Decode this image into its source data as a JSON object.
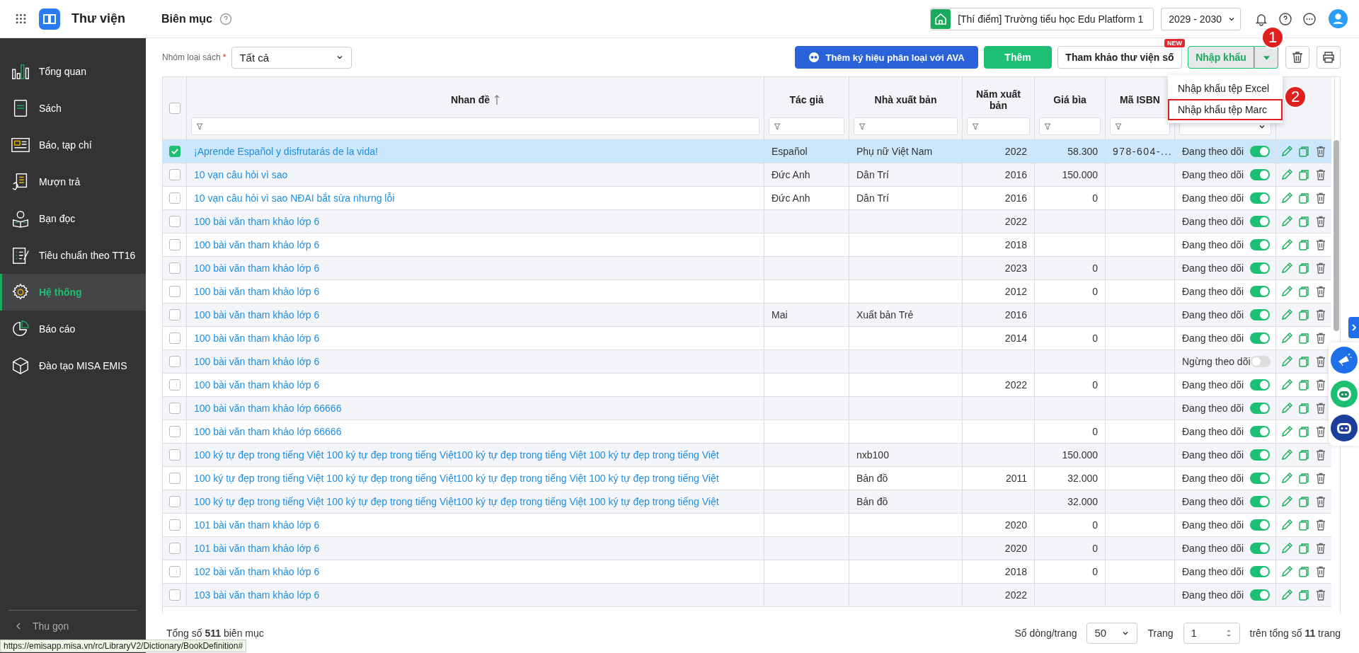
{
  "app": {
    "name": "Thư viện",
    "page_title": "Biên mục",
    "school": "[Thí điểm] Trường tiểu học Edu Platform 1",
    "year": "2029 - 2030"
  },
  "sidebar": {
    "items": [
      {
        "label": "Tổng quan",
        "selected": false
      },
      {
        "label": "Sách",
        "selected": false
      },
      {
        "label": "Báo, tạp chí",
        "selected": false
      },
      {
        "label": "Mượn trả",
        "selected": false
      },
      {
        "label": "Bạn đọc",
        "selected": false
      },
      {
        "label": "Tiêu chuẩn theo TT16",
        "selected": false
      },
      {
        "label": "Hệ thống",
        "selected": true
      },
      {
        "label": "Báo cáo",
        "selected": false
      },
      {
        "label": "Đào tạo MISA EMIS",
        "selected": false
      }
    ],
    "collapse": "Thu gọn"
  },
  "toolbar": {
    "filter_label": "Nhóm loại sách",
    "required_mark": "*",
    "filter_value": "Tất cả",
    "buttons": [
      {
        "label": "Thêm ký hiệu phân loại với AVA",
        "kind": "ava"
      },
      {
        "label": "Thêm",
        "kind": "primary"
      },
      {
        "label": "Tham khảo thư viện số",
        "kind": "outline",
        "badge": "NEW"
      },
      {
        "label": "Nhập khẩu",
        "kind": "split"
      }
    ],
    "import_menu": [
      {
        "label": "Nhập khẩu tệp Excel",
        "highlighted": false
      },
      {
        "label": "Nhập khẩu tệp Marc",
        "highlighted": true
      }
    ],
    "step_markers": [
      "1",
      "2"
    ]
  },
  "table": {
    "all_checked": false,
    "columns": [
      "Nhan đề",
      "Tác giả",
      "Nhà xuất bản",
      "Năm xuất bản",
      "Giá bìa",
      "Mã ISBN"
    ],
    "rows": [
      {
        "selected": true,
        "title": "¡Aprende Español y disfrutarás de la vida!",
        "author": "Español",
        "publisher": "Phụ nữ Việt Nam",
        "year": "2022",
        "price": "58.300",
        "isbn": "978-604-...",
        "status": "Đang theo dõi",
        "on": true
      },
      {
        "selected": false,
        "title": "10 vạn câu hỏi vì sao",
        "author": "Đức Anh",
        "publisher": "Dân Trí",
        "year": "2016",
        "price": "150.000",
        "isbn": "",
        "status": "Đang theo dõi",
        "on": true
      },
      {
        "selected": false,
        "title": "10 vạn câu hỏi vì sao NĐAI bắt sửa nhưng lỗi",
        "author": "Đức Anh",
        "publisher": "Dân Trí",
        "year": "2016",
        "price": "0",
        "isbn": "",
        "status": "Đang theo dõi",
        "on": true
      },
      {
        "selected": false,
        "title": "100 bài văn tham khảo lớp 6",
        "author": "",
        "publisher": "",
        "year": "2022",
        "price": "",
        "isbn": "",
        "status": "Đang theo dõi",
        "on": true
      },
      {
        "selected": false,
        "title": "100 bài văn tham khảo lớp 6",
        "author": "",
        "publisher": "",
        "year": "2018",
        "price": "",
        "isbn": "",
        "status": "Đang theo dõi",
        "on": true
      },
      {
        "selected": false,
        "title": "100 bài văn tham khảo lớp 6",
        "author": "",
        "publisher": "",
        "year": "2023",
        "price": "0",
        "isbn": "",
        "status": "Đang theo dõi",
        "on": true
      },
      {
        "selected": false,
        "title": "100 bài văn tham khảo lớp 6",
        "author": "",
        "publisher": "",
        "year": "2012",
        "price": "0",
        "isbn": "",
        "status": "Đang theo dõi",
        "on": true
      },
      {
        "selected": false,
        "title": "100 bài văn tham khảo lớp 6",
        "author": "Mai",
        "publisher": "Xuất bản Trẻ",
        "year": "2016",
        "price": "",
        "isbn": "",
        "status": "Đang theo dõi",
        "on": true
      },
      {
        "selected": false,
        "title": "100 bài văn tham khảo lớp 6",
        "author": "",
        "publisher": "",
        "year": "2014",
        "price": "0",
        "isbn": "",
        "status": "Đang theo dõi",
        "on": true
      },
      {
        "selected": false,
        "title": "100 bài văn tham khảo lớp 6",
        "author": "",
        "publisher": "",
        "year": "",
        "price": "",
        "isbn": "",
        "status": "Ngừng theo dõi",
        "on": false
      },
      {
        "selected": false,
        "title": "100 bài văn tham khảo lớp 6",
        "author": "",
        "publisher": "",
        "year": "2022",
        "price": "0",
        "isbn": "",
        "status": "Đang theo dõi",
        "on": true
      },
      {
        "selected": false,
        "title": "100 bài văn tham khảo lớp 66666",
        "author": "",
        "publisher": "",
        "year": "",
        "price": "",
        "isbn": "",
        "status": "Đang theo dõi",
        "on": true
      },
      {
        "selected": false,
        "title": "100 bài văn tham khảo lớp 66666",
        "author": "",
        "publisher": "",
        "year": "",
        "price": "0",
        "isbn": "",
        "status": "Đang theo dõi",
        "on": true
      },
      {
        "selected": false,
        "title": "100 ký tự đẹp trong tiếng Việt 100 ký tự đẹp trong tiếng Việt100 ký tự đẹp trong tiếng Việt 100 ký tự đẹp trong tiếng Việt",
        "author": "",
        "publisher": "nxb100",
        "year": "",
        "price": "150.000",
        "isbn": "",
        "status": "Đang theo dõi",
        "on": true
      },
      {
        "selected": false,
        "title": "100 ký tự đẹp trong tiếng Việt 100 ký tự đẹp trong tiếng Việt100 ký tự đẹp trong tiếng Việt 100 ký tự đẹp trong tiếng Việt",
        "author": "",
        "publisher": "Bản đồ",
        "year": "2011",
        "price": "32.000",
        "isbn": "",
        "status": "Đang theo dõi",
        "on": true
      },
      {
        "selected": false,
        "title": "100 ký tự đẹp trong tiếng Việt 100 ký tự đẹp trong tiếng Việt100 ký tự đẹp trong tiếng Việt 100 ký tự đẹp trong tiếng Việt",
        "author": "",
        "publisher": "Bản đồ",
        "year": "",
        "price": "32.000",
        "isbn": "",
        "status": "Đang theo dõi",
        "on": true
      },
      {
        "selected": false,
        "title": "101 bài văn tham khảo lớp 6",
        "author": "",
        "publisher": "",
        "year": "2020",
        "price": "0",
        "isbn": "",
        "status": "Đang theo dõi",
        "on": true
      },
      {
        "selected": false,
        "title": "101 bài văn tham khảo lớp 6",
        "author": "",
        "publisher": "",
        "year": "2020",
        "price": "0",
        "isbn": "",
        "status": "Đang theo dõi",
        "on": true
      },
      {
        "selected": false,
        "title": "102 bài văn tham khảo lớp 6",
        "author": "",
        "publisher": "",
        "year": "2018",
        "price": "0",
        "isbn": "",
        "status": "Đang theo dõi",
        "on": true
      },
      {
        "selected": false,
        "title": "103 bài văn tham khảo lớp 6",
        "author": "",
        "publisher": "",
        "year": "2022",
        "price": "",
        "isbn": "",
        "status": "Đang theo dõi",
        "on": true
      }
    ]
  },
  "footer": {
    "total": "Tổng số **511** biên mục",
    "rows_label": "Số dòng/trang",
    "page_size": "50",
    "page_label": "Trang",
    "page": "1",
    "pages": "trên tổng số **11** trang"
  },
  "status_url": "https://emisapp.misa.vn/rc/LibraryV2/Dictionary/BookDefinition#"
}
